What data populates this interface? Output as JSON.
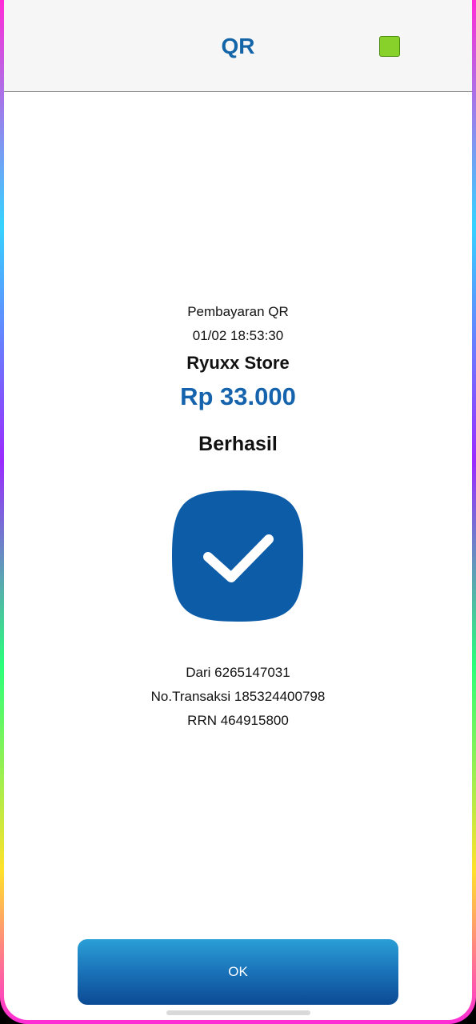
{
  "header": {
    "title": "QR"
  },
  "receipt": {
    "subtitle": "Pembayaran QR",
    "datetime": "01/02 18:53:30",
    "merchant": "Ryuxx Store",
    "amount": "Rp 33.000",
    "status": "Berhasil",
    "from": "Dari 6265147031",
    "transaction": "No.Transaksi 185324400798",
    "rrn": "RRN 464915800"
  },
  "actions": {
    "ok_label": "OK"
  },
  "colors": {
    "accent": "#1463ac",
    "status_indicator": "#88d02a",
    "check_badge": "#0d5ca8"
  }
}
